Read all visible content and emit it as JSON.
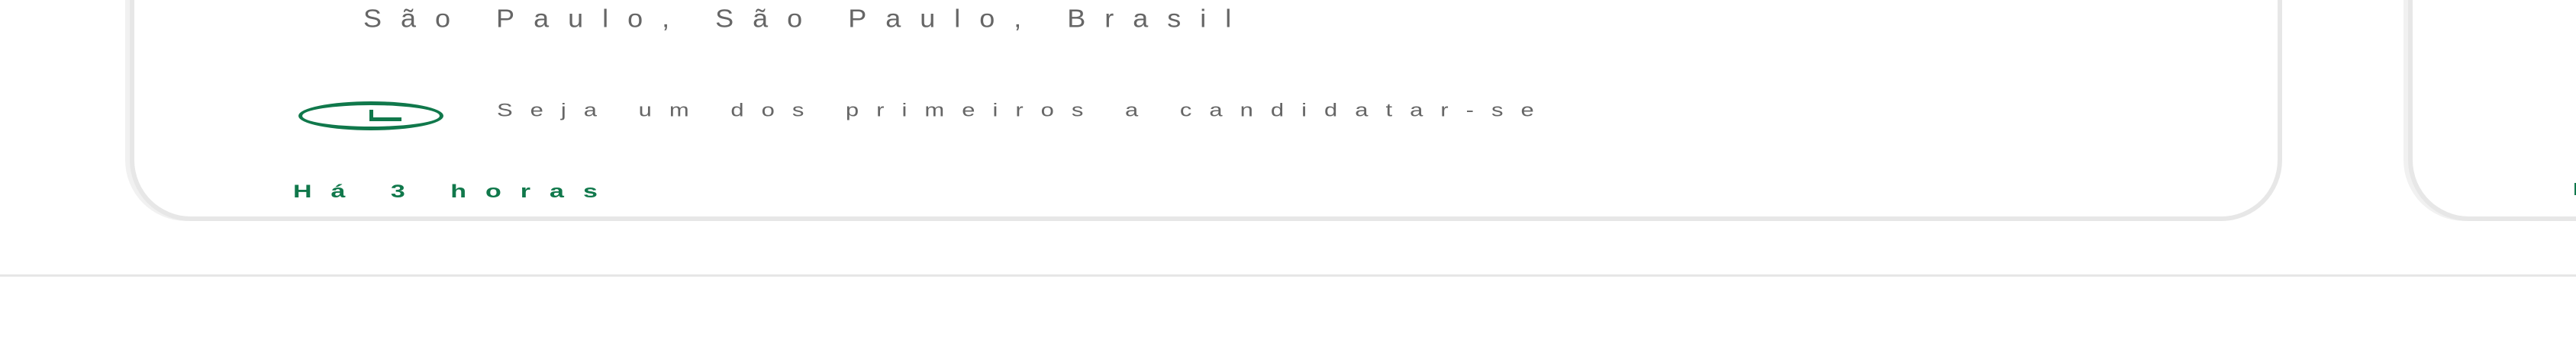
{
  "job_cards": [
    {
      "location": "São Paulo, São Paulo, Brasil",
      "applicant_hint": "Seja um dos primeiros a candidatar-se",
      "posted_time": "Há 3 horas",
      "icon": "clock-icon"
    }
  ],
  "colors": {
    "accent_green": "#10784b",
    "secondary_text": "#666666",
    "card_border": "#e7e7e7"
  }
}
